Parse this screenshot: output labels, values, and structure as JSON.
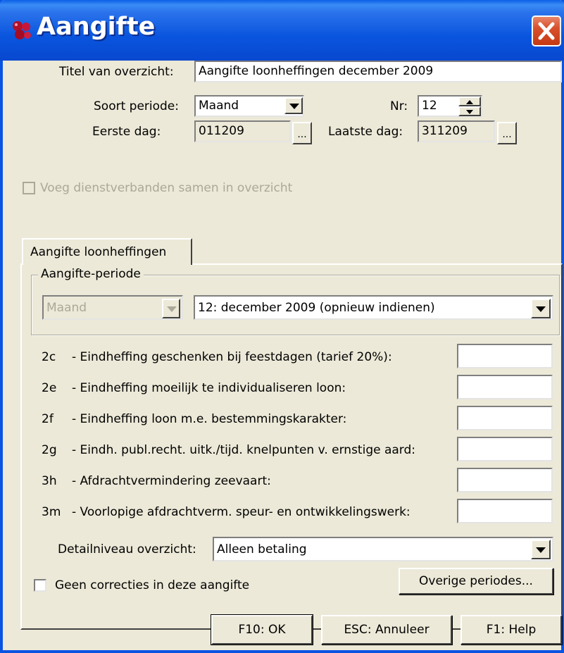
{
  "window": {
    "title": "Aangifte",
    "close_label": "X"
  },
  "header": {
    "titel_label": "Titel van overzicht:",
    "titel_value": "Aangifte loonheffingen december 2009",
    "soort_periode_label": "Soort periode:",
    "soort_periode_value": "Maand",
    "nr_label": "Nr:",
    "nr_value": "12",
    "eerste_dag_label": "Eerste dag:",
    "eerste_dag_value": "011209",
    "laatste_dag_label": "Laatste dag:",
    "laatste_dag_value": "311209",
    "picker_label": "..."
  },
  "voeg_checkbox": {
    "label": "Voeg dienstverbanden samen in overzicht",
    "checked": false,
    "enabled": false
  },
  "tabs": [
    {
      "label": "Aangifte loonheffingen",
      "active": true
    }
  ],
  "aangifte_periode": {
    "group_label": "Aangifte-periode",
    "type_value": "Maand",
    "periode_value": "12: december 2009 (opnieuw indienen)"
  },
  "lines": [
    {
      "code": "2c",
      "label": "- Eindheffing geschenken bij feestdagen (tarief 20%):",
      "value": ""
    },
    {
      "code": "2e",
      "label": "- Eindheffing moeilijk te individualiseren loon:",
      "value": ""
    },
    {
      "code": "2f",
      "label": "- Eindheffing loon m.e. bestemmingskarakter:",
      "value": ""
    },
    {
      "code": "2g",
      "label": "- Eindh. publ.recht. uitk./tijd. knelpunten v. ernstige aard:",
      "value": ""
    },
    {
      "code": "3h",
      "label": "- Afdrachtvermindering zeevaart:",
      "value": ""
    },
    {
      "code": "3m",
      "label": "- Voorlopige afdrachtverm. speur- en ontwikkelingswerk:",
      "value": ""
    }
  ],
  "detail": {
    "label": "Detailniveau overzicht:",
    "value": "Alleen betaling"
  },
  "geen_correcties": {
    "label": "Geen correcties in deze aangifte",
    "checked": false
  },
  "buttons": {
    "overige_periodes": "Overige periodes...",
    "ok": "F10: OK",
    "annuleer": "ESC: Annuleer",
    "help": "F1: Help"
  },
  "colors": {
    "title_bar": "#0a55de",
    "window_bg": "#ece9d8",
    "close_button": "#d8502c",
    "disabled_text": "#aca899"
  },
  "icons": {
    "app": "app-logo-icon",
    "close": "close-icon",
    "dropdown": "chevron-down-icon",
    "spinner_up": "spinner-up-icon",
    "spinner_down": "spinner-down-icon"
  }
}
